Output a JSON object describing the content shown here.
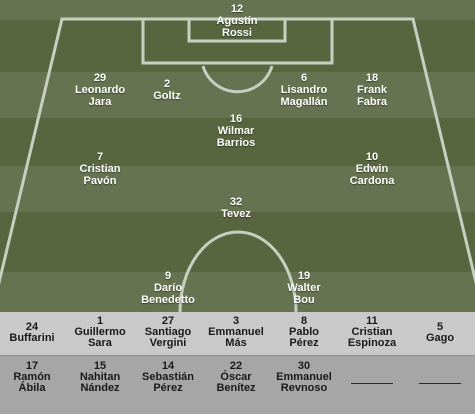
{
  "pitch": {
    "colors": {
      "stripe_light": "#667350",
      "stripe_dark": "#58653f",
      "line": "#c8cec0"
    },
    "players": [
      {
        "id": "rossi",
        "number": "12",
        "first": "Agustín",
        "last": "Rossi"
      },
      {
        "id": "jara",
        "number": "29",
        "first": "Leonardo",
        "last": "Jara"
      },
      {
        "id": "goltz",
        "number": "2",
        "first": "",
        "last": "Goltz"
      },
      {
        "id": "magallan",
        "number": "6",
        "first": "Lisandro",
        "last": "Magallán"
      },
      {
        "id": "fabra",
        "number": "18",
        "first": "Frank",
        "last": "Fabra"
      },
      {
        "id": "barrios",
        "number": "16",
        "first": "Wilmar",
        "last": "Barrios"
      },
      {
        "id": "pavon",
        "number": "7",
        "first": "Cristian",
        "last": "Pavón"
      },
      {
        "id": "cardona",
        "number": "10",
        "first": "Edwin",
        "last": "Cardona"
      },
      {
        "id": "tevez",
        "number": "32",
        "first": "",
        "last": "Tevez"
      },
      {
        "id": "benedetto",
        "number": "9",
        "first": "Darío",
        "last": "Benedetto"
      },
      {
        "id": "bou",
        "number": "19",
        "first": "Walter",
        "last": "Bou"
      }
    ]
  },
  "bench": {
    "top": [
      {
        "number": "24",
        "first": "",
        "last": "Buffarini"
      },
      {
        "number": "1",
        "first": "Guillermo",
        "last": "Sara"
      },
      {
        "number": "27",
        "first": "Santiago",
        "last": "Vergini"
      },
      {
        "number": "3",
        "first": "Emmanuel",
        "last": "Más"
      },
      {
        "number": "8",
        "first": "Pablo",
        "last": "Pérez"
      },
      {
        "number": "11",
        "first": "Cristian",
        "last": "Espinoza"
      },
      {
        "number": "5",
        "first": "",
        "last": "Gago"
      }
    ],
    "bottom": [
      {
        "number": "17",
        "first": "Ramón",
        "last": "Ábila"
      },
      {
        "number": "15",
        "first": "Nahitan",
        "last": "Nández"
      },
      {
        "number": "14",
        "first": "Sebastián",
        "last": "Pérez"
      },
      {
        "number": "22",
        "first": "Óscar",
        "last": "Benítez"
      },
      {
        "number": "30",
        "first": "Emmanuel",
        "last": "Revnoso"
      },
      {
        "number": "",
        "first": "",
        "last": ""
      },
      {
        "number": "",
        "first": "",
        "last": ""
      }
    ]
  }
}
